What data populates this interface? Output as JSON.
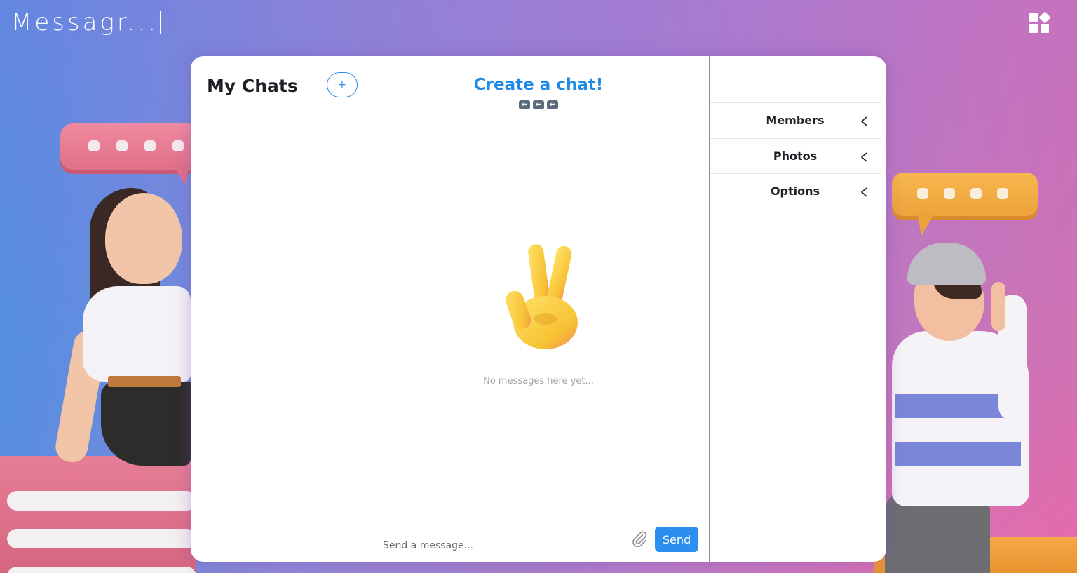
{
  "app": {
    "title": "Messagr..."
  },
  "sidebar": {
    "title": "My Chats",
    "add_label": "+"
  },
  "chat": {
    "title": "Create a chat!",
    "arrows": [
      "⬅",
      "⬅",
      "⬅"
    ],
    "empty_text": "No messages here yet...",
    "input_placeholder": "Send a message...",
    "send_label": "Send"
  },
  "details": {
    "items": [
      {
        "label": "Members"
      },
      {
        "label": "Photos"
      },
      {
        "label": "Options"
      }
    ]
  },
  "colors": {
    "accent": "#2b8ff0",
    "title_accent": "#1e8ae6",
    "text": "#1f2026",
    "muted": "#a3a3a8"
  },
  "icons": [
    "widget-icon",
    "paperclip-icon",
    "chevron-left-icon",
    "peace-hand-icon",
    "arrow-left-icon"
  ]
}
